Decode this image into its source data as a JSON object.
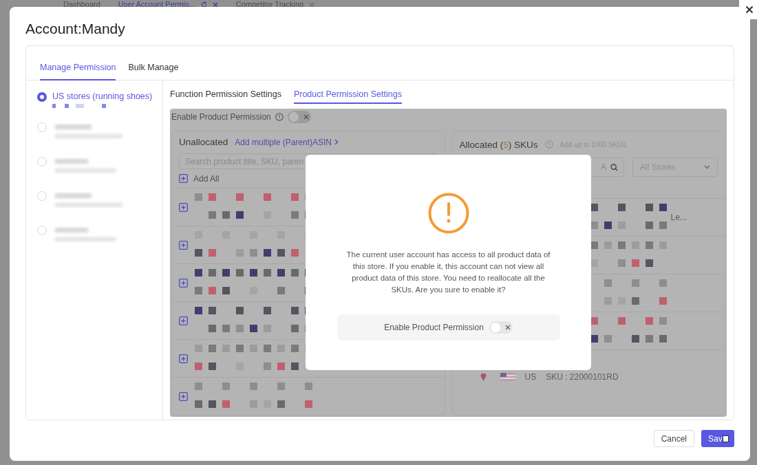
{
  "background_tabs": [
    {
      "label": "Dashboard",
      "selected": false,
      "closable": false
    },
    {
      "label": "User Account Permis...",
      "selected": true,
      "closable": true
    },
    {
      "label": "Competitor Tracking",
      "selected": false,
      "closable": true
    }
  ],
  "dialog": {
    "title": "Account:Mandy",
    "tabs": [
      {
        "label": "Manage Permission",
        "selected": true
      },
      {
        "label": "Bulk Manage",
        "selected": false
      }
    ],
    "stores": [
      {
        "label": "US stores (running shoes)",
        "selected": true
      },
      {
        "selected": false
      },
      {
        "selected": false
      },
      {
        "selected": false
      },
      {
        "selected": false
      }
    ],
    "subtabs": [
      {
        "label": "Function Permission Settings",
        "selected": false
      },
      {
        "label": "Product Permission Settings",
        "selected": true
      }
    ],
    "product_permission": {
      "label": "Enable Product Permission",
      "on": false
    },
    "unallocated": {
      "title": "Unallocated",
      "link": "Add multiple (Parent)ASIN",
      "search_placeholder": "Search product title, SKU, paren",
      "add_all": "Add All",
      "rows": [
        {
          "kind": "product"
        },
        {
          "kind": "product"
        },
        {
          "kind": "product"
        },
        {
          "kind": "product"
        },
        {
          "kind": "product"
        },
        {
          "kind": "product"
        }
      ]
    },
    "allocated": {
      "title_start": "Allocated (",
      "count": "5",
      "title_end": ") SKUs",
      "hint": "Add up to 1000 SKUs",
      "search_value": "A",
      "store_filter": "All Stores",
      "rows": [
        {
          "kind": "product",
          "trailing": "Le..."
        },
        {
          "kind": "product"
        },
        {
          "kind": "product"
        },
        {
          "kind": "product"
        },
        {
          "kind": "sku",
          "country": "US",
          "sku": "SKU : 22000101RD"
        }
      ]
    },
    "confirm": {
      "message": "The current user account has access to all product data of this store. If you enable it, this account can not view all product data of this store. You need to reallocate all the SKUs. Are you sure to enable it?",
      "toggle_label": "Enable Product Permission",
      "on": false
    },
    "footer": {
      "cancel": "Cancel",
      "save": "Sav"
    }
  }
}
